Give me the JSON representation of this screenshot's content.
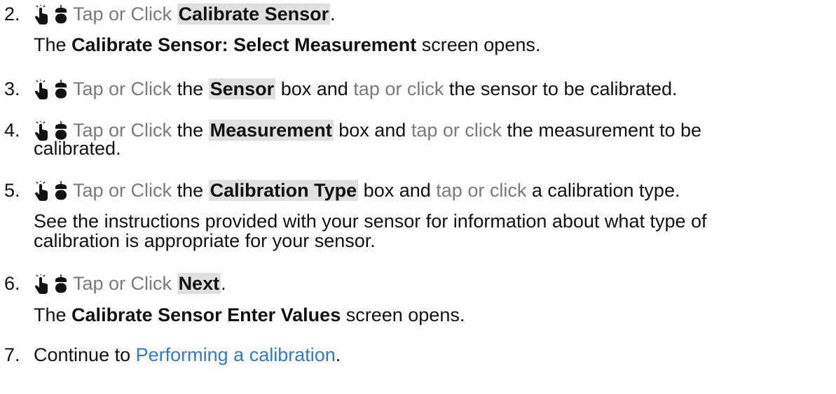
{
  "steps": [
    {
      "num": "2.",
      "action_label": "Tap or Click",
      "control": "Calibrate Sensor",
      "trail": ".",
      "note_pre": "The",
      "note_ui": "Calibrate Sensor: Select Measurement",
      "note_post": "screen opens."
    },
    {
      "num": "3.",
      "action_label": "Tap or Click",
      "mid1": "the",
      "control": "Sensor",
      "mid2": "box and",
      "action2": "tap or click",
      "rest": "the sensor to be calibrated."
    },
    {
      "num": "4.",
      "action_label": "Tap or Click",
      "mid1": "the",
      "control": "Measurement",
      "mid2": "box and",
      "action2": "tap or click",
      "rest": "the measurement to be",
      "rest2": "calibrated."
    },
    {
      "num": "5.",
      "action_label": "Tap or Click",
      "mid1": "the",
      "control": "Calibration Type",
      "mid2": "box and",
      "action2": "tap or click",
      "rest": "a calibration type.",
      "note_line1": "See the instructions provided with your sensor for information about what type of",
      "note_line2": "calibration is appropriate for your sensor."
    },
    {
      "num": "6.",
      "action_label": "Tap or Click",
      "control": "Next",
      "trail": ".",
      "note_pre": "The",
      "note_ui": "Calibrate Sensor Enter Values",
      "note_post": "screen opens."
    },
    {
      "num": "7.",
      "text": "Continue to",
      "link": "Performing a calibration",
      "trail": "."
    }
  ],
  "icons": {
    "touch": "hand-tap-icon",
    "mouse": "mouse-icon"
  },
  "colors": {
    "action_gray": "#7a7a7a",
    "ui_highlight": "#e0e0e0",
    "link": "#2f7cc1"
  }
}
